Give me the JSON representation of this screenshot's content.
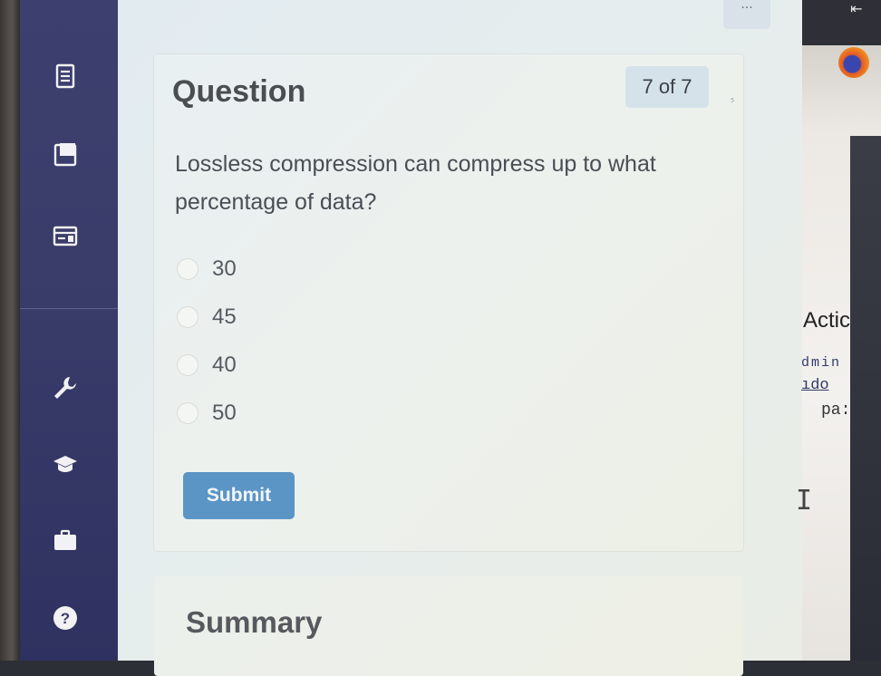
{
  "sidebar": {
    "icons": [
      "document-list-icon",
      "notebook-icon",
      "layout-icon",
      "wrench-icon",
      "graduation-cap-icon",
      "briefcase-icon",
      "help-icon"
    ]
  },
  "question": {
    "title": "Question",
    "counter": "7 of 7",
    "text": "Lossless compression can compress up to what percentage of data?",
    "options": [
      {
        "label": "30"
      },
      {
        "label": "45"
      },
      {
        "label": "40"
      },
      {
        "label": "50"
      }
    ],
    "submit_label": "Submit"
  },
  "summary": {
    "title": "Summary"
  },
  "toolbar": {
    "more_label": "..."
  },
  "background_window": {
    "text_1": "Actic",
    "text_2": "dmin",
    "text_3": "ıdo",
    "text_4": "pa:"
  },
  "colors": {
    "sidebar_bg": "#3d3f6e",
    "submit_bg": "#5b95c5",
    "counter_bg": "#d5e2ea"
  }
}
